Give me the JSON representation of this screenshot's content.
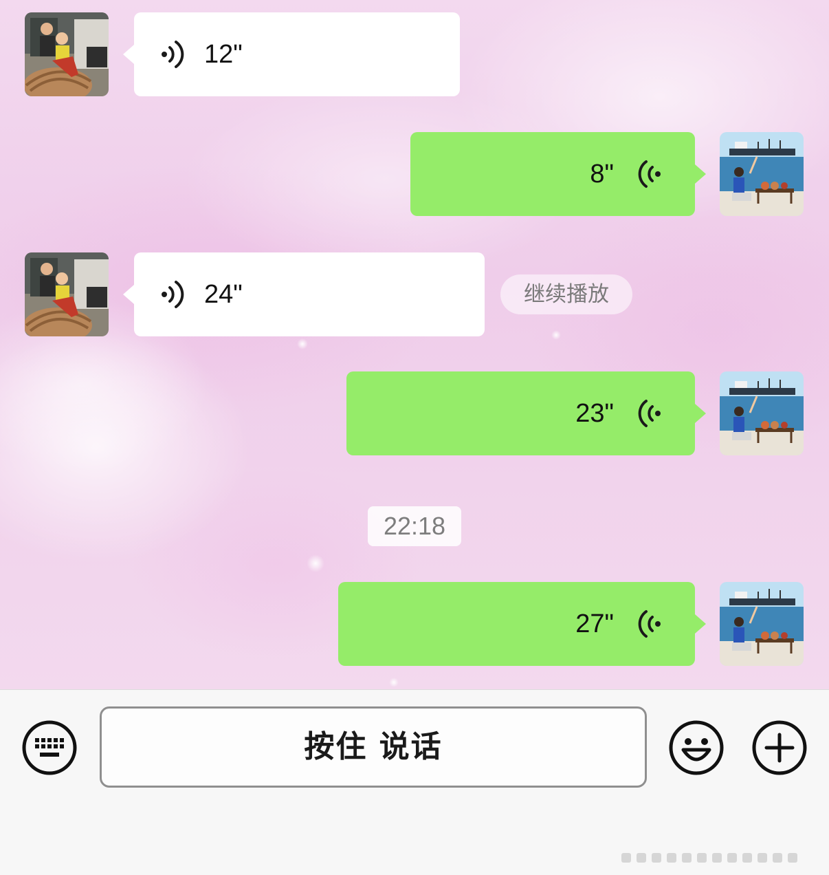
{
  "messages": [
    {
      "side": "in",
      "duration": "12\""
    },
    {
      "side": "out",
      "duration": "8\""
    },
    {
      "side": "in",
      "duration": "24\""
    },
    {
      "side": "out",
      "duration": "23\""
    },
    {
      "side": "out",
      "duration": "27\""
    }
  ],
  "continue_play_label": "继续播放",
  "timestamp": "22:18",
  "input_bar": {
    "hold_to_talk_label": "按住 说话",
    "left_icon": "keyboard-icon",
    "emoji_icon": "emoji-icon",
    "plus_icon": "plus-icon"
  },
  "colors": {
    "incoming_bubble": "#ffffff",
    "outgoing_bubble": "#95ec69",
    "background": "#f1d3ec"
  }
}
